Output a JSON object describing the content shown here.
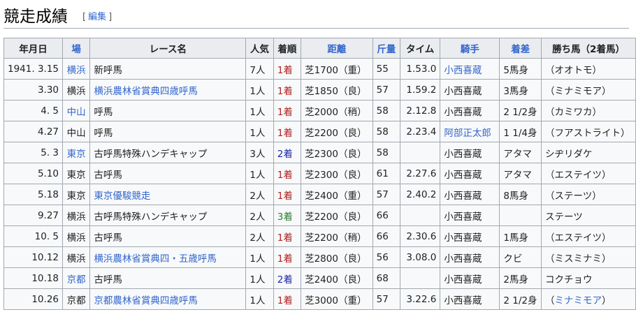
{
  "section": {
    "title": "競走成績",
    "edit_open": "[",
    "edit_label": "編集",
    "edit_close": "]"
  },
  "columns": [
    {
      "label": "年月日",
      "link": false
    },
    {
      "label": "場",
      "link": true
    },
    {
      "label": "レース名",
      "link": false
    },
    {
      "label": "人気",
      "link": false
    },
    {
      "label": "着順",
      "link": false
    },
    {
      "label": "距離",
      "link": true
    },
    {
      "label": "斤量",
      "link": true
    },
    {
      "label": "タイム",
      "link": false
    },
    {
      "label": "騎手",
      "link": true
    },
    {
      "label": "着差",
      "link": true
    },
    {
      "label": "勝ち馬（2着馬）",
      "link": false
    }
  ],
  "rows": [
    {
      "date": "1941. 3.15",
      "venue": "横浜",
      "venue_link": true,
      "race": "新呼馬",
      "race_link": false,
      "pop": "7人",
      "place": "1着",
      "place_num": 1,
      "dist": "芝1700（重）",
      "weight": "55",
      "time": "1.53.0",
      "jockey": "小西喜蔵",
      "jockey_link": true,
      "margin": "5馬身",
      "winner": "（オオトモ）",
      "winner_parts": [
        {
          "t": "（オオトモ）",
          "link": false
        }
      ]
    },
    {
      "date": "3.30",
      "venue": "横浜",
      "venue_link": false,
      "race": "横浜農林省賞典四歳呼馬",
      "race_link": true,
      "pop": "1人",
      "place": "1着",
      "place_num": 1,
      "dist": "芝1850（良）",
      "weight": "57",
      "time": "1.59.2",
      "jockey": "小西喜蔵",
      "jockey_link": false,
      "margin": "3馬身",
      "winner_parts": [
        {
          "t": "（ミナミモア）",
          "link": false
        }
      ]
    },
    {
      "date": "4. 5",
      "venue": "中山",
      "venue_link": true,
      "race": "呼馬",
      "race_link": false,
      "pop": "1人",
      "place": "1着",
      "place_num": 1,
      "dist": "芝2000（稍）",
      "weight": "58",
      "time": "2.12.8",
      "jockey": "小西喜蔵",
      "jockey_link": false,
      "margin": "2 1/2身",
      "winner_parts": [
        {
          "t": "（カミワカ）",
          "link": false
        }
      ]
    },
    {
      "date": "4.27",
      "venue": "中山",
      "venue_link": false,
      "race": "呼馬",
      "race_link": false,
      "pop": "1人",
      "place": "1着",
      "place_num": 1,
      "dist": "芝2200（良）",
      "weight": "58",
      "time": "2.23.4",
      "jockey": "阿部正太郎",
      "jockey_link": true,
      "margin": "1 1/4身",
      "winner_parts": [
        {
          "t": "（フアストライト）",
          "link": false
        }
      ]
    },
    {
      "date": "5. 3",
      "venue": "東京",
      "venue_link": true,
      "race": "古呼馬特殊ハンデキャップ",
      "race_link": false,
      "pop": "3人",
      "place": "2着",
      "place_num": 2,
      "dist": "芝2300（良）",
      "weight": "58",
      "time": "",
      "jockey": "小西喜蔵",
      "jockey_link": false,
      "margin": "アタマ",
      "winner_parts": [
        {
          "t": "シヂリダケ",
          "link": false
        }
      ]
    },
    {
      "date": "5.10",
      "venue": "東京",
      "venue_link": false,
      "race": "古呼馬",
      "race_link": false,
      "pop": "1人",
      "place": "1着",
      "place_num": 1,
      "dist": "芝2300（良）",
      "weight": "61",
      "time": "2.27.6",
      "jockey": "小西喜蔵",
      "jockey_link": false,
      "margin": "アタマ",
      "winner_parts": [
        {
          "t": "（エステイツ）",
          "link": false
        }
      ]
    },
    {
      "date": "5.18",
      "venue": "東京",
      "venue_link": false,
      "race": "東京優駿競走",
      "race_link": true,
      "pop": "2人",
      "place": "1着",
      "place_num": 1,
      "dist": "芝2400（重）",
      "weight": "57",
      "time": "2.40.2",
      "jockey": "小西喜蔵",
      "jockey_link": false,
      "margin": "8馬身",
      "winner_parts": [
        {
          "t": "（ステーツ）",
          "link": false
        }
      ]
    },
    {
      "date": "9.27",
      "venue": "横浜",
      "venue_link": false,
      "race": "古呼馬特殊ハンデキャップ",
      "race_link": false,
      "pop": "2人",
      "place": "3着",
      "place_num": 3,
      "dist": "芝2200（良）",
      "weight": "66",
      "time": "",
      "jockey": "小西喜蔵",
      "jockey_link": false,
      "margin": "",
      "winner_parts": [
        {
          "t": "ステーツ",
          "link": false
        }
      ]
    },
    {
      "date": "10. 5",
      "venue": "横浜",
      "venue_link": false,
      "race": "古呼馬",
      "race_link": false,
      "pop": "2人",
      "place": "1着",
      "place_num": 1,
      "dist": "芝2200（稍）",
      "weight": "66",
      "time": "2.30.6",
      "jockey": "小西喜蔵",
      "jockey_link": false,
      "margin": "1馬身",
      "winner_parts": [
        {
          "t": "（エステイツ）",
          "link": false
        }
      ]
    },
    {
      "date": "10.12",
      "venue": "横浜",
      "venue_link": false,
      "race": "横浜農林省賞典四・五歳呼馬",
      "race_link": true,
      "pop": "1人",
      "place": "1着",
      "place_num": 1,
      "dist": "芝2800（良）",
      "weight": "56",
      "time": "3.08.0",
      "jockey": "小西喜蔵",
      "jockey_link": false,
      "margin": "クビ",
      "winner_parts": [
        {
          "t": "（ミスミナミ）",
          "link": false
        }
      ]
    },
    {
      "date": "10.18",
      "venue": "京都",
      "venue_link": true,
      "race": "古呼馬",
      "race_link": false,
      "pop": "1人",
      "place": "2着",
      "place_num": 2,
      "dist": "芝2400（良）",
      "weight": "68",
      "time": "",
      "jockey": "小西喜蔵",
      "jockey_link": false,
      "margin": "2馬身",
      "winner_parts": [
        {
          "t": "コクチョウ",
          "link": false
        }
      ]
    },
    {
      "date": "10.26",
      "venue": "京都",
      "venue_link": false,
      "race": "京都農林省賞典四歳呼馬",
      "race_link": true,
      "pop": "1人",
      "place": "1着",
      "place_num": 1,
      "dist": "芝3000（重）",
      "weight": "57",
      "time": "3.22.6",
      "jockey": "小西喜蔵",
      "jockey_link": false,
      "margin": "2 1/2身",
      "winner_parts": [
        {
          "t": "（",
          "link": false
        },
        {
          "t": "ミナミモア",
          "link": true
        },
        {
          "t": "）",
          "link": false
        }
      ]
    }
  ]
}
